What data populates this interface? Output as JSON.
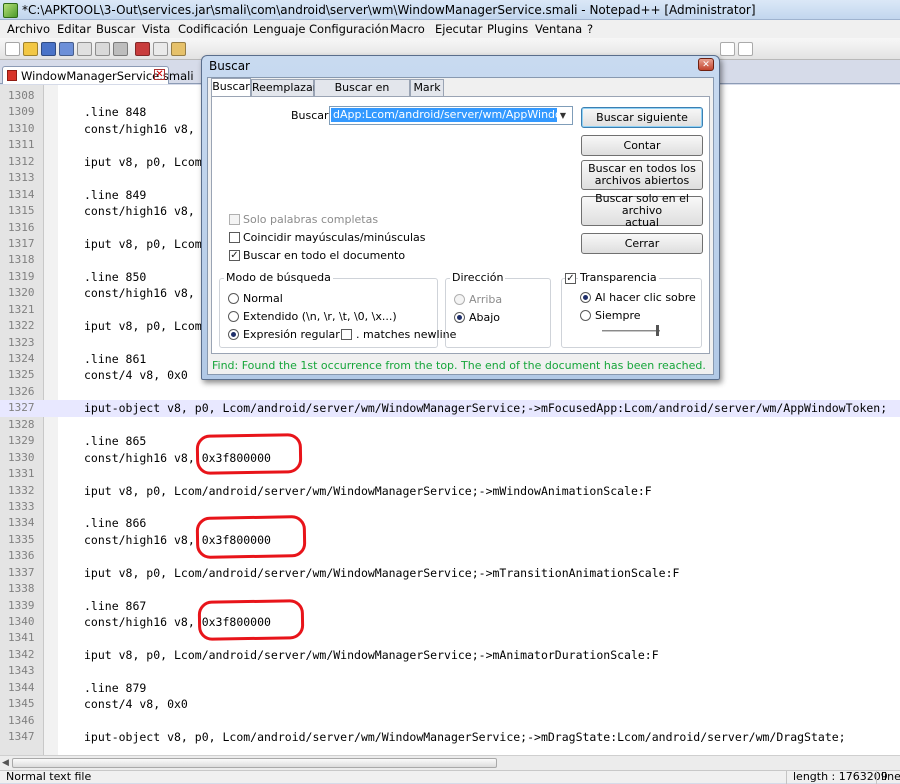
{
  "window": {
    "title": "*C:\\APKTOOL\\3-Out\\services.jar\\smali\\com\\android\\server\\wm\\WindowManagerService.smali - Notepad++ [Administrator]"
  },
  "menu": [
    "Archivo",
    "Editar",
    "Buscar",
    "Vista",
    "Codificación",
    "Lenguaje",
    "Configuración",
    "Macro",
    "Ejecutar",
    "Plugins",
    "Ventana",
    "?"
  ],
  "doc_tab": {
    "label": "WindowManagerService.smali"
  },
  "editor": {
    "lines": [
      {
        "n": "1308",
        "code": ""
      },
      {
        "n": "1309",
        "code": ".line 848"
      },
      {
        "n": "1310",
        "code": "const/high16 v8, 0x3f800000"
      },
      {
        "n": "1311",
        "code": ""
      },
      {
        "n": "1312",
        "code": "iput v8, p0, Lcom/android/server/wm/WindowManagerService;->mWindowAnimationScale:F"
      },
      {
        "n": "1313",
        "code": ""
      },
      {
        "n": "1314",
        "code": ".line 849"
      },
      {
        "n": "1315",
        "code": "const/high16 v8, 0x3f800000"
      },
      {
        "n": "1316",
        "code": ""
      },
      {
        "n": "1317",
        "code": "iput v8, p0, Lcom/android/server/wm/WindowManagerService;->mTransitionAnimationScale:F"
      },
      {
        "n": "1318",
        "code": ""
      },
      {
        "n": "1319",
        "code": ".line 850"
      },
      {
        "n": "1320",
        "code": "const/high16 v8, 0x3f800000"
      },
      {
        "n": "1321",
        "code": ""
      },
      {
        "n": "1322",
        "code": "iput v8, p0, Lcom/android/server/wm/WindowManagerService;->mAnimatorDurationScale:F"
      },
      {
        "n": "1323",
        "code": ""
      },
      {
        "n": "1324",
        "code": ".line 861"
      },
      {
        "n": "1325",
        "code": "const/4 v8, 0x0"
      },
      {
        "n": "1326",
        "code": ""
      },
      {
        "n": "1327",
        "code": "iput-object v8, p0, Lcom/android/server/wm/WindowManagerService;->mFocusedApp:Lcom/android/server/wm/AppWindowToken;"
      },
      {
        "n": "1328",
        "code": ""
      },
      {
        "n": "1329",
        "code": ".line 865"
      },
      {
        "n": "1330",
        "code": "const/high16 v8, 0x3f800000"
      },
      {
        "n": "1331",
        "code": ""
      },
      {
        "n": "1332",
        "code": "iput v8, p0, Lcom/android/server/wm/WindowManagerService;->mWindowAnimationScale:F"
      },
      {
        "n": "1333",
        "code": ""
      },
      {
        "n": "1334",
        "code": ".line 866"
      },
      {
        "n": "1335",
        "code": "const/high16 v8, 0x3f800000"
      },
      {
        "n": "1336",
        "code": ""
      },
      {
        "n": "1337",
        "code": "iput v8, p0, Lcom/android/server/wm/WindowManagerService;->mTransitionAnimationScale:F"
      },
      {
        "n": "1338",
        "code": ""
      },
      {
        "n": "1339",
        "code": ".line 867"
      },
      {
        "n": "1340",
        "code": "const/high16 v8, 0x3f800000"
      },
      {
        "n": "1341",
        "code": ""
      },
      {
        "n": "1342",
        "code": "iput v8, p0, Lcom/android/server/wm/WindowManagerService;->mAnimatorDurationScale:F"
      },
      {
        "n": "1343",
        "code": ""
      },
      {
        "n": "1344",
        "code": ".line 879"
      },
      {
        "n": "1345",
        "code": "const/4 v8, 0x0"
      },
      {
        "n": "1346",
        "code": ""
      },
      {
        "n": "1347",
        "code": "iput-object v8, p0, Lcom/android/server/wm/WindowManagerService;->mDragState:Lcom/android/server/wm/DragState;"
      }
    ]
  },
  "status": {
    "type": "Normal text file",
    "length": "length : 1763209",
    "line": "line"
  },
  "dialog": {
    "title": "Buscar",
    "tabs": [
      "Buscar",
      "Reemplazar",
      "Buscar en archivos",
      "Mark"
    ],
    "find_label": "Buscar:",
    "find_value": "dApp:Lcom/android/server/wm/AppWindowToken",
    "buttons": {
      "find_next": "Buscar siguiente",
      "count": "Contar",
      "find_all_open_l1": "Buscar en todos los",
      "find_all_open_l2": "archivos abiertos",
      "find_in_current_l1": "Buscar solo en el archivo",
      "find_in_current_l2": "actual",
      "close": "Cerrar"
    },
    "options": {
      "whole_word": "Solo palabras completas",
      "match_case": "Coincidir mayúsculas/minúsculas",
      "wrap": "Buscar en todo el documento"
    },
    "search_mode": {
      "label": "Modo de búsqueda",
      "normal": "Normal",
      "extended": "Extendido (\\n, \\r, \\t, \\0, \\x...)",
      "regex": "Expresión regular",
      "newline": ". matches newline"
    },
    "direction": {
      "label": "Dirección",
      "up": "Arriba",
      "down": "Abajo"
    },
    "transparency": {
      "label": "Transparencia",
      "on_lose_focus": "Al hacer clic sobre el arc",
      "always": "Siempre",
      "level": 0.95
    },
    "status": "Find: Found the 1st occurrence from the top. The end of the document has been reached."
  }
}
